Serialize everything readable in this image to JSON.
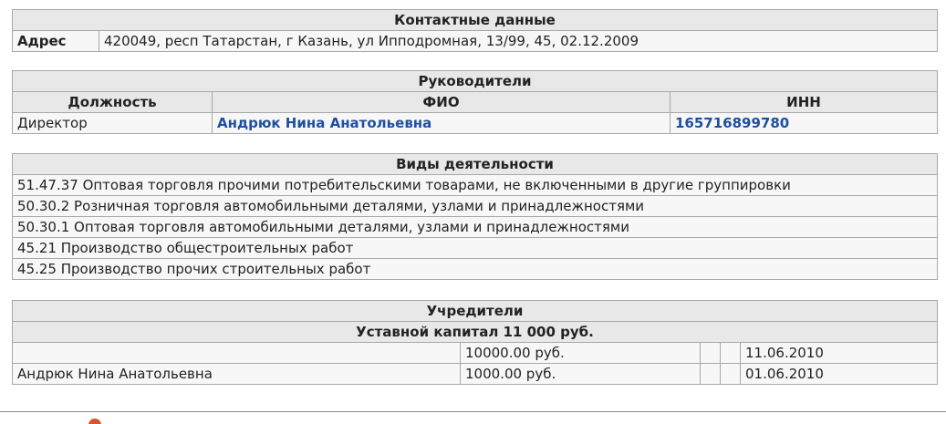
{
  "contacts": {
    "title": "Контактные данные",
    "address_label": "Адрес",
    "address_value": "420049, респ Татарстан, г Казань, ул Ипподромная, 13/99, 45, 02.12.2009"
  },
  "managers": {
    "title": "Руководители",
    "columns": [
      "Должность",
      "ФИО",
      "ИНН"
    ],
    "rows": [
      {
        "position": "Директор",
        "name": "Андрюк Нина Анатольевна",
        "inn": "165716899780"
      }
    ]
  },
  "activities": {
    "title": "Виды деятельности",
    "items": [
      "51.47.37 Оптовая торговля прочими потребительскими товарами, не включенными в другие группировки",
      "50.30.2 Розничная торговля автомобильными деталями, узлами и принадлежностями",
      "50.30.1 Оптовая торговля автомобильными деталями, узлами и принадлежностями",
      "45.21 Производство общестроительных работ",
      "45.25 Производство прочих строительных работ"
    ]
  },
  "founders": {
    "title": "Учредители",
    "capital": "Уставной капитал 11 000 руб.",
    "rows": [
      {
        "name": "",
        "amount": "10000.00 руб.",
        "col3": "",
        "col4": "",
        "date": "11.06.2010"
      },
      {
        "name": "Андрюк Нина Анатольевна",
        "amount": "1000.00 руб.",
        "col3": "",
        "col4": "",
        "date": "01.06.2010"
      }
    ]
  },
  "footer": {
    "text": "",
    "icon": "circle-icon",
    "icon_color": "#d9552a"
  },
  "colors": {
    "link": "#1f4fa0",
    "header_bg": "#e8e8e8",
    "border": "#a8a8a8"
  }
}
